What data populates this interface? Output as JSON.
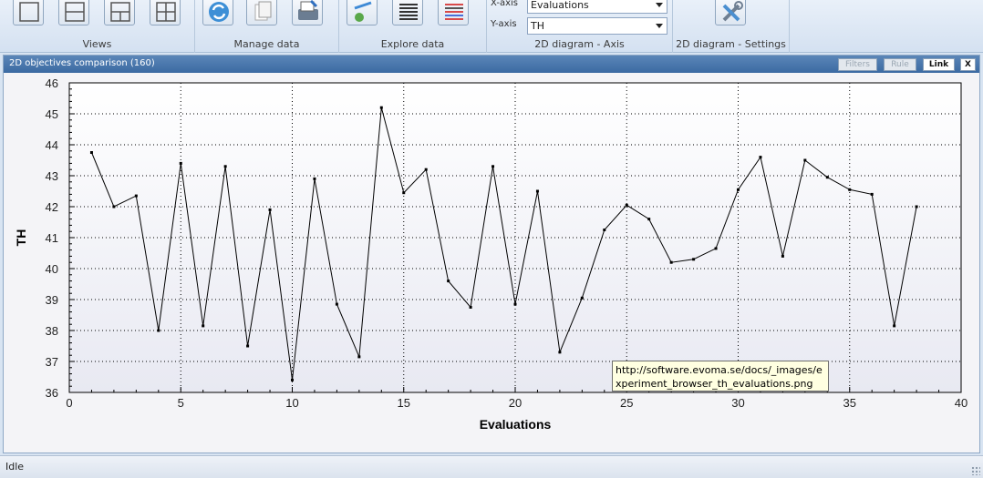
{
  "ribbon": {
    "views_label": "Views",
    "manage_label": "Manage data",
    "explore_label": "Explore data",
    "axis_label": "2D diagram - Axis",
    "settings_label": "2D diagram - Settings",
    "x_axis_label": "X-axis",
    "x_axis_value": "Evaluations",
    "y_axis_label": "Y-axis",
    "y_axis_value": "TH"
  },
  "panel": {
    "title": "2D objectives comparison (160)",
    "filters_label": "Filters",
    "rule_label": "Rule",
    "link_label": "Link",
    "close_label": "X"
  },
  "tooltip": "http://software.evoma.se/docs/_images/experiment_browser_th_evaluations.png",
  "status": "Idle",
  "chart_data": {
    "type": "line",
    "title": "",
    "xlabel": "Evaluations",
    "ylabel": "TH",
    "xlim": [
      0,
      40
    ],
    "ylim": [
      36,
      46
    ],
    "xticks": [
      0,
      5,
      10,
      15,
      20,
      25,
      30,
      35,
      40
    ],
    "yticks": [
      36,
      37,
      38,
      39,
      40,
      41,
      42,
      43,
      44,
      45,
      46
    ],
    "grid": true,
    "series": [
      {
        "x": [
          1,
          2,
          3,
          4,
          5,
          6,
          7,
          8,
          9,
          10,
          11,
          12,
          13,
          14,
          15,
          16,
          17,
          18,
          19,
          20,
          21,
          22,
          23,
          24,
          25,
          26,
          27,
          28,
          29,
          30,
          31,
          32,
          33,
          34,
          35,
          36,
          37,
          38
        ],
        "values": [
          43.75,
          42.0,
          42.35,
          38.0,
          43.4,
          38.15,
          43.3,
          37.5,
          41.9,
          36.4,
          42.9,
          38.85,
          37.15,
          45.2,
          42.45,
          43.2,
          39.6,
          38.75,
          43.3,
          38.85,
          42.5,
          37.3,
          39.05,
          41.25,
          42.05,
          41.6,
          40.2,
          40.3,
          40.65,
          42.55,
          43.6,
          40.4,
          43.5,
          42.95,
          42.55,
          42.4,
          38.15,
          42.0
        ],
        "color": "#000000"
      }
    ]
  }
}
